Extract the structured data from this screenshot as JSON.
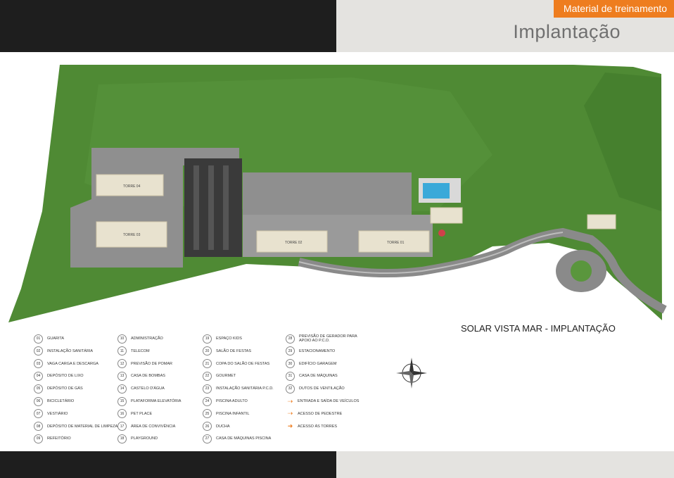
{
  "header": {
    "badge": "Material de treinamento",
    "title": "Implantação"
  },
  "map": {
    "title": "SOLAR VISTA MAR - IMPLANTAÇÃO",
    "towers": [
      "TORRE 04",
      "TORRE 03",
      "TORRE 02",
      "TORRE 01"
    ],
    "legend_col1": [
      {
        "num": "01",
        "label": "GUARITA"
      },
      {
        "num": "02",
        "label": "INSTALAÇÃO SANITÁRIA"
      },
      {
        "num": "03",
        "label": "VAGA CARGA E DESCARGA"
      },
      {
        "num": "04",
        "label": "DEPÓSITO DE LIXO"
      },
      {
        "num": "05",
        "label": "DEPÓSITO DE GÁS"
      },
      {
        "num": "06",
        "label": "BICICLETÁRIO"
      },
      {
        "num": "07",
        "label": "VESTIÁRIO"
      },
      {
        "num": "08",
        "label": "DEPÓSITO DE MATERIAL DE LIMPEZA"
      },
      {
        "num": "09",
        "label": "REFEITÓRIO"
      }
    ],
    "legend_col2": [
      {
        "num": "10",
        "label": "ADMINISTRAÇÃO"
      },
      {
        "num": "11",
        "label": "TELECOM"
      },
      {
        "num": "12",
        "label": "PREVISÃO DE POMAR"
      },
      {
        "num": "13",
        "label": "CASA DE BOMBAS"
      },
      {
        "num": "14",
        "label": "CASTELO D'ÁGUA"
      },
      {
        "num": "15",
        "label": "PLATAFORMA ELEVATÓRIA"
      },
      {
        "num": "16",
        "label": "PET PLACE"
      },
      {
        "num": "17",
        "label": "ÁREA DE CONVIVÊNCIA"
      },
      {
        "num": "18",
        "label": "PLAYGROUND"
      }
    ],
    "legend_col3": [
      {
        "num": "19",
        "label": "ESPAÇO KIDS"
      },
      {
        "num": "20",
        "label": "SALÃO DE FESTAS"
      },
      {
        "num": "21",
        "label": "COPA DO SALÃO DE FESTAS"
      },
      {
        "num": "22",
        "label": "GOURMET"
      },
      {
        "num": "23",
        "label": "INSTALAÇÃO SANITÁRIA P.C.D."
      },
      {
        "num": "24",
        "label": "PISCINA ADULTO"
      },
      {
        "num": "25",
        "label": "PISCINA INFANTIL"
      },
      {
        "num": "26",
        "label": "DUCHA"
      },
      {
        "num": "27",
        "label": "CASA DE MÁQUINAS PISCINA"
      }
    ],
    "legend_col4": [
      {
        "num": "28",
        "label": "PREVISÃO DE GERADOR PARA APOIO AO P.C.D."
      },
      {
        "num": "29",
        "label": "ESTACIONAMENTO"
      },
      {
        "num": "30",
        "label": "EDIFÍCIO GARAGEM"
      },
      {
        "num": "31",
        "label": "CASA DE MÁQUINAS"
      },
      {
        "num": "32",
        "label": "DUTOS DE VENTILAÇÃO"
      }
    ],
    "legend_arrows": [
      {
        "icon": "vehicle-arrow-icon",
        "label": "ENTRADA E SAÍDA DE VEÍCULOS"
      },
      {
        "icon": "pedestrian-arrow-icon",
        "label": "ACESSO  DE PEDESTRE"
      },
      {
        "icon": "tower-access-arrow-icon",
        "label": "ACESSO ÀS TORRES"
      }
    ],
    "colors": {
      "grass": "#4f8a34",
      "road": "#8c8c8c",
      "building": "#e8e2cf",
      "accent": "#ee7d1f"
    }
  }
}
